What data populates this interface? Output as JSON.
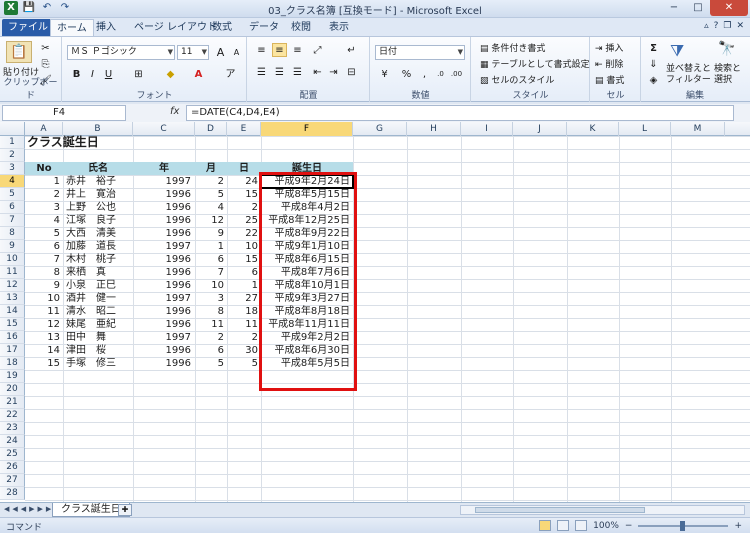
{
  "window": {
    "title": "03_クラス名簿 [互換モード] - Microsoft Excel",
    "minimize": "−",
    "maximize": "□",
    "close": "✕"
  },
  "qat": {
    "app_icon": "X",
    "save": "💾",
    "undo": "↶",
    "redo": "↷"
  },
  "tabs": [
    {
      "label": "ファイル"
    },
    {
      "label": "ホーム"
    },
    {
      "label": "挿入"
    },
    {
      "label": "ページ レイアウト"
    },
    {
      "label": "数式"
    },
    {
      "label": "データ"
    },
    {
      "label": "校閲"
    },
    {
      "label": "表示"
    }
  ],
  "ribbon": {
    "clipboard": {
      "paste": "貼り付け",
      "label": "クリップボード"
    },
    "font": {
      "name": "ＭＳ Ｐゴシック",
      "size": "11",
      "bold": "B",
      "italic": "I",
      "underline": "U",
      "label": "フォント"
    },
    "alignment": {
      "label": "配置"
    },
    "number": {
      "format": "日付",
      "label": "数値"
    },
    "styles": {
      "conditional": "条件付き書式",
      "table": "テーブルとして書式設定",
      "cell": "セルのスタイル",
      "label": "スタイル"
    },
    "cells": {
      "insert": "挿入",
      "delete": "削除",
      "format": "書式",
      "label": "セル"
    },
    "editing": {
      "sort": "並べ替えと",
      "filter": "フィルター",
      "find": "検索と",
      "select": "選択",
      "label": "編集"
    }
  },
  "formula_bar": {
    "name_box": "F4",
    "fx": "fx",
    "formula": "=DATE(C4,D4,E4)"
  },
  "columns": [
    "A",
    "B",
    "C",
    "D",
    "E",
    "F",
    "G",
    "H",
    "I",
    "J",
    "K",
    "L",
    "M"
  ],
  "rows": [
    "1",
    "2",
    "3",
    "4",
    "5",
    "6",
    "7",
    "8",
    "9",
    "10",
    "11",
    "12",
    "13",
    "14",
    "15",
    "16",
    "17",
    "18",
    "19",
    "20",
    "21",
    "22",
    "23",
    "24",
    "25",
    "26",
    "27",
    "28"
  ],
  "sheet": {
    "title": "クラス誕生日",
    "headers": {
      "no": "No",
      "name": "氏名",
      "year": "年",
      "month": "月",
      "day": "日",
      "birthday": "誕生日"
    },
    "records": [
      {
        "no": "1",
        "name": "赤井　裕子",
        "year": "1997",
        "month": "2",
        "day": "24",
        "birthday": "平成9年2月24日"
      },
      {
        "no": "2",
        "name": "井上　寛治",
        "year": "1996",
        "month": "5",
        "day": "15",
        "birthday": "平成8年5月15日"
      },
      {
        "no": "3",
        "name": "上野　公也",
        "year": "1996",
        "month": "4",
        "day": "2",
        "birthday": "平成8年4月2日"
      },
      {
        "no": "4",
        "name": "江塚　良子",
        "year": "1996",
        "month": "12",
        "day": "25",
        "birthday": "平成8年12月25日"
      },
      {
        "no": "5",
        "name": "大西　清美",
        "year": "1996",
        "month": "9",
        "day": "22",
        "birthday": "平成8年9月22日"
      },
      {
        "no": "6",
        "name": "加藤　道長",
        "year": "1997",
        "month": "1",
        "day": "10",
        "birthday": "平成9年1月10日"
      },
      {
        "no": "7",
        "name": "木村　桃子",
        "year": "1996",
        "month": "6",
        "day": "15",
        "birthday": "平成8年6月15日"
      },
      {
        "no": "8",
        "name": "来栖　真",
        "year": "1996",
        "month": "7",
        "day": "6",
        "birthday": "平成8年7月6日"
      },
      {
        "no": "9",
        "name": "小泉　正巳",
        "year": "1996",
        "month": "10",
        "day": "1",
        "birthday": "平成8年10月1日"
      },
      {
        "no": "10",
        "name": "酒井　健一",
        "year": "1997",
        "month": "3",
        "day": "27",
        "birthday": "平成9年3月27日"
      },
      {
        "no": "11",
        "name": "清水　昭二",
        "year": "1996",
        "month": "8",
        "day": "18",
        "birthday": "平成8年8月18日"
      },
      {
        "no": "12",
        "name": "妹尾　亜紀",
        "year": "1996",
        "month": "11",
        "day": "11",
        "birthday": "平成8年11月11日"
      },
      {
        "no": "13",
        "name": "田中　舞",
        "year": "1997",
        "month": "2",
        "day": "2",
        "birthday": "平成9年2月2日"
      },
      {
        "no": "14",
        "name": "津田　桜",
        "year": "1996",
        "month": "6",
        "day": "30",
        "birthday": "平成8年6月30日"
      },
      {
        "no": "15",
        "name": "手塚　修三",
        "year": "1996",
        "month": "5",
        "day": "5",
        "birthday": "平成8年5月5日"
      }
    ]
  },
  "sheet_tab": {
    "label": "クラス誕生日"
  },
  "status": {
    "mode": "コマンド",
    "zoom": "100%",
    "zoom_out": "−",
    "zoom_in": "+"
  },
  "colors": {
    "highlight_box": "#e01010",
    "header_band": "#b7dde8",
    "selection_header": "#f8d878"
  }
}
